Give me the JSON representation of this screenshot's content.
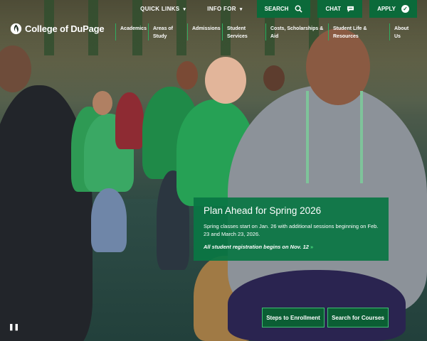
{
  "site": {
    "name": "College of DuPage",
    "logo_icon": "cod-flame-icon"
  },
  "utility_nav": {
    "quick_links": "QUICK LINKS",
    "info_for": "INFO FOR",
    "search": "SEARCH",
    "chat": "CHAT",
    "apply": "APPLY"
  },
  "main_nav": [
    {
      "label": "Academics"
    },
    {
      "label": "Areas of Study"
    },
    {
      "label": "Admissions"
    },
    {
      "label": "Student Services"
    },
    {
      "label": "Costs, Scholarships & Aid"
    },
    {
      "label": "Student Life & Resources"
    },
    {
      "label": "About Us"
    }
  ],
  "callout": {
    "title": "Plan Ahead for Spring 2026",
    "body": "Spring classes start on Jan. 26 with additional sessions beginning on Feb. 23 and March 23, 2026.",
    "link": "All student registration begins on Nov. 12",
    "link_arrow": "»"
  },
  "cta_buttons": {
    "steps": "Steps to Enrollment",
    "search_courses": "Search for Courses"
  },
  "media": {
    "pause_glyph": "❚❚"
  },
  "colors": {
    "brand_green": "#0b6a3a",
    "accent_green": "#2eae61"
  }
}
